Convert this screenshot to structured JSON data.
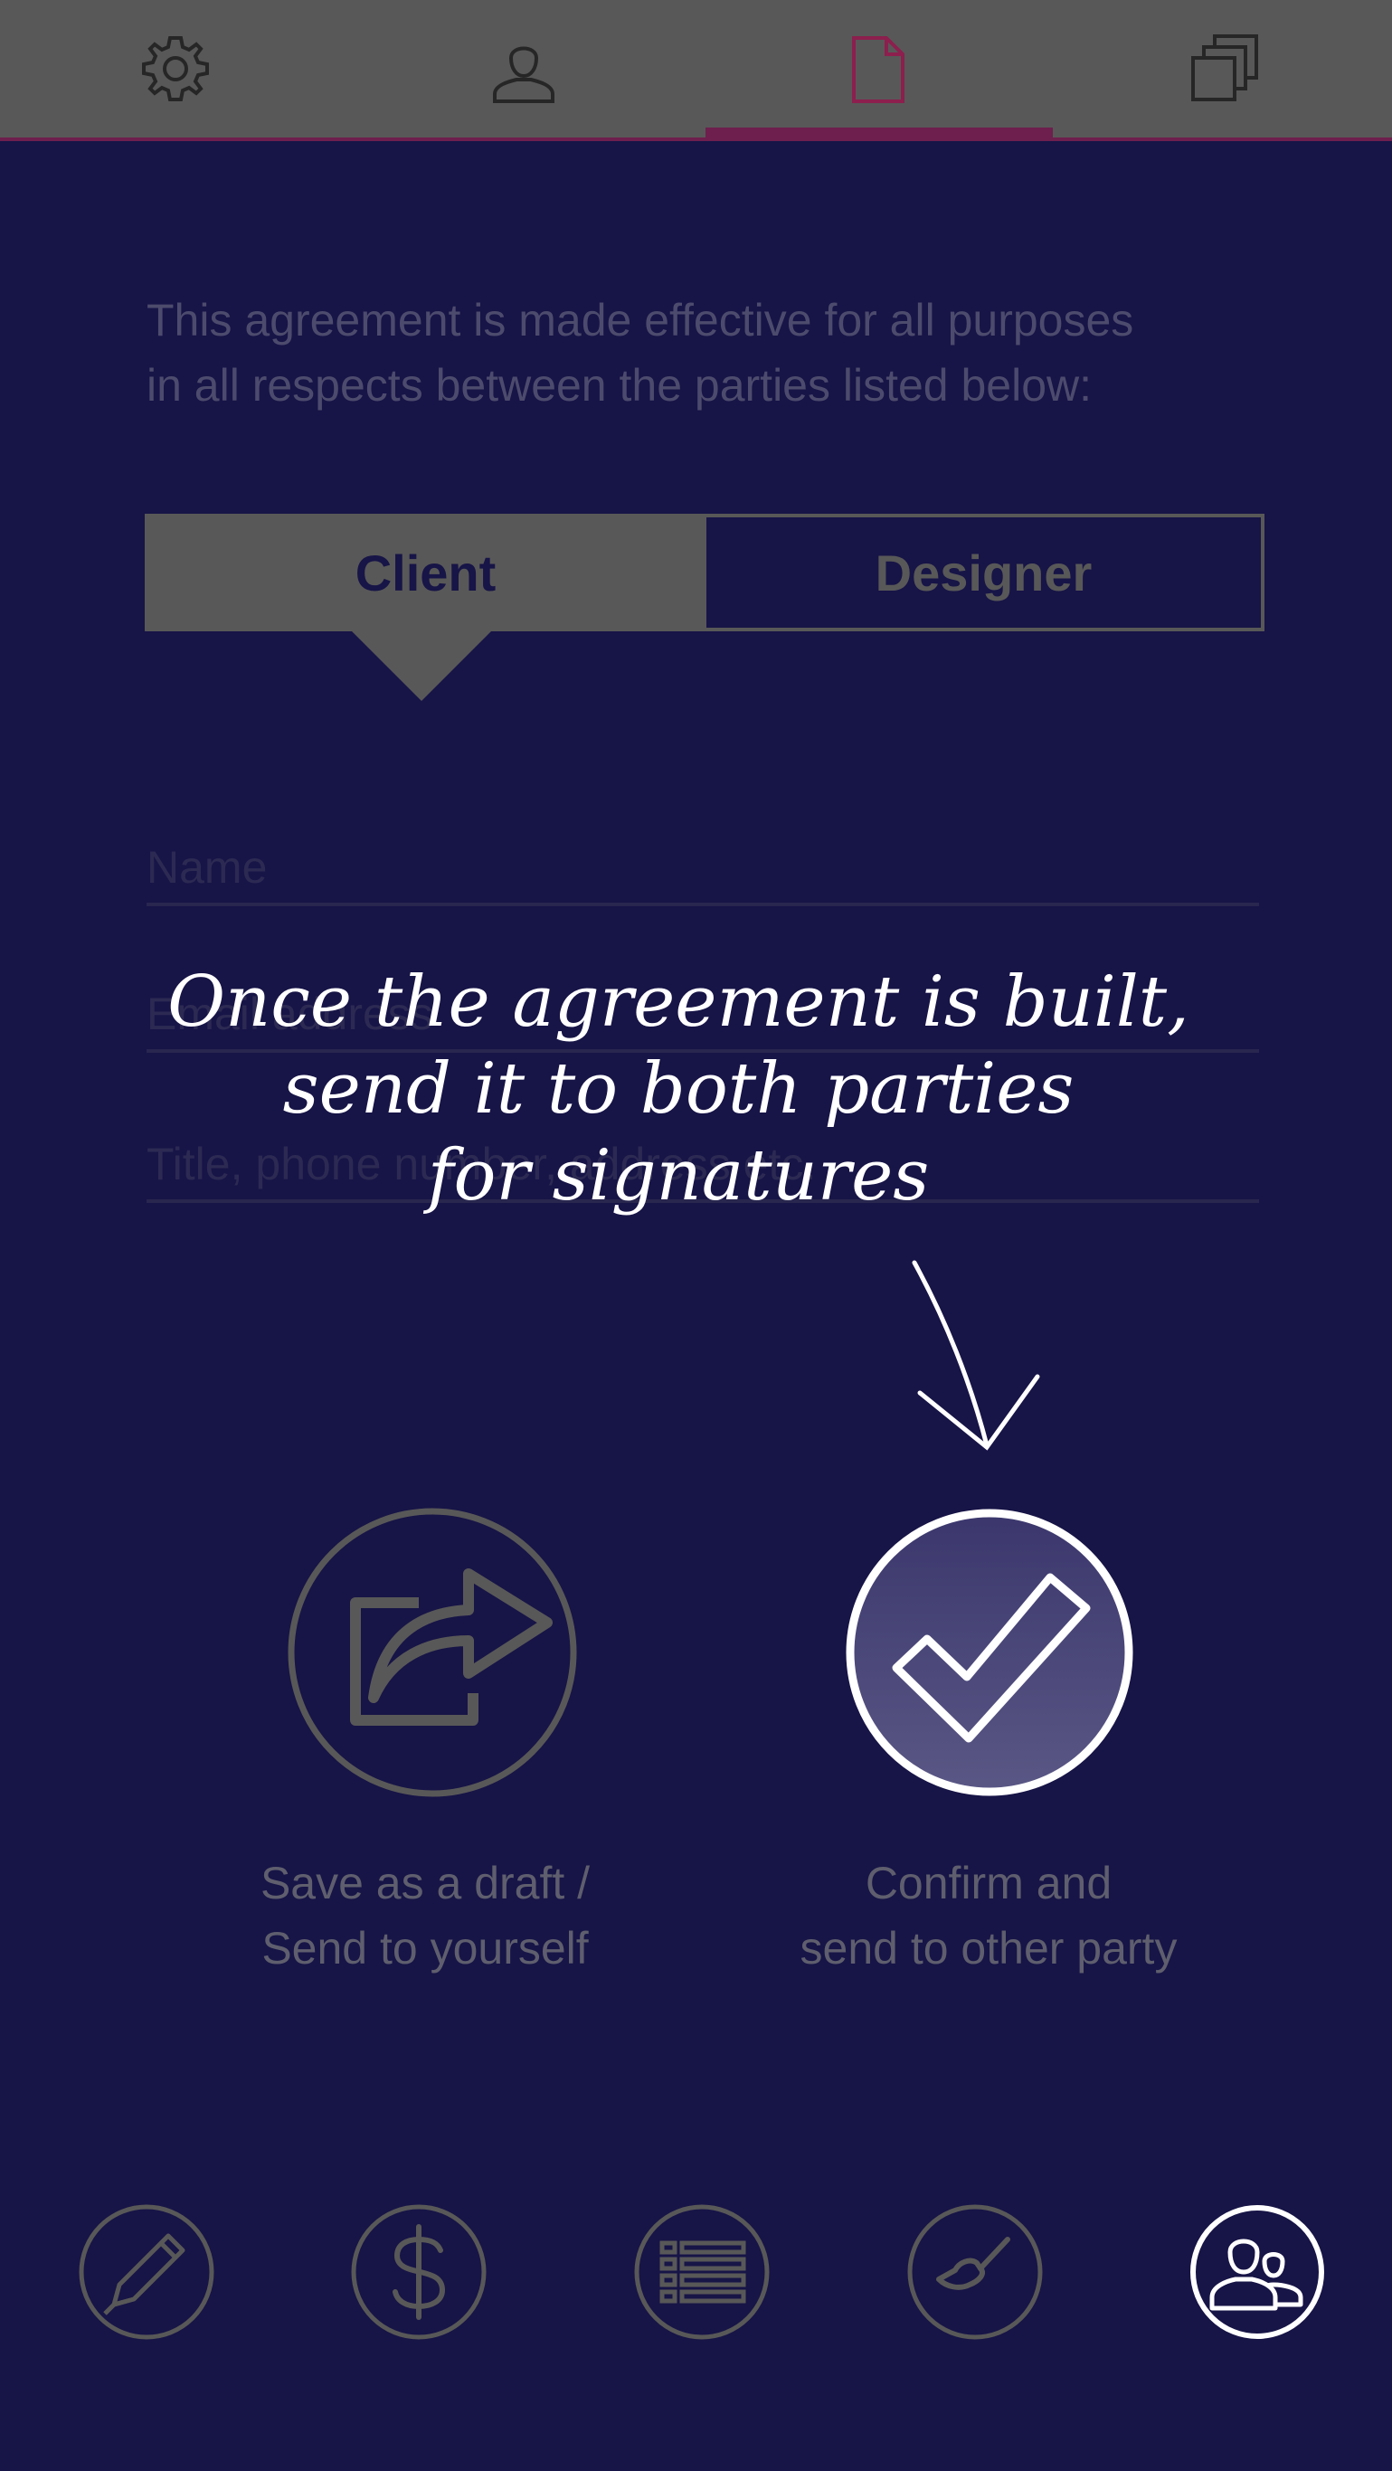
{
  "nav": {
    "tabs": [
      {
        "icon": "gear-icon"
      },
      {
        "icon": "user-icon"
      },
      {
        "icon": "document-icon",
        "active": true
      },
      {
        "icon": "copies-icon"
      }
    ],
    "accent": "#6e1f4e"
  },
  "agreement": {
    "intro_line1": "This agreement is made effective for all purposes",
    "intro_line2": "in all respects between the parties listed below:"
  },
  "party_switch": {
    "client_label": "Client",
    "designer_label": "Designer",
    "selected": "Client"
  },
  "fields": {
    "name_placeholder": "Name",
    "email_placeholder": "Email address",
    "details_placeholder": "Title, phone number, address etc."
  },
  "callout": {
    "line1": "Once the agreement is built,",
    "line2": "send it to both parties",
    "line3": "for signatures"
  },
  "actions": {
    "save_line1": "Save as a draft /",
    "save_line2": "Send to yourself",
    "confirm_line1": "Confirm and",
    "confirm_line2": "send to other party"
  },
  "bottom_nav": {
    "items": [
      "pencil-icon",
      "dollar-icon",
      "list-icon",
      "paintbrush-icon",
      "people-icon"
    ],
    "active": "people-icon"
  },
  "colors": {
    "background": "#171447",
    "topbar": "#585858",
    "muted": "#585858",
    "highlight": "#ffffff"
  }
}
